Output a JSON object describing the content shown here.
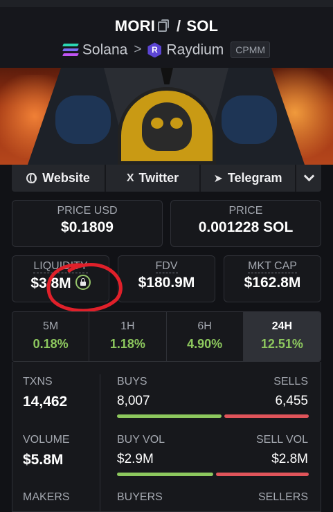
{
  "pair": {
    "base": "MORI",
    "separator": "/",
    "quote": "SOL"
  },
  "chain": {
    "network": "Solana",
    "dex": "Raydium",
    "dex_icon_letter": "R",
    "pool_type": "CPMM"
  },
  "icons": [
    "copy-icon",
    "solana-icon",
    "chevron-right-icon",
    "raydium-icon",
    "globe-icon",
    "x-icon",
    "telegram-icon",
    "chevron-down-icon",
    "lock-icon"
  ],
  "socials": {
    "website": "Website",
    "twitter": "Twitter",
    "telegram": "Telegram",
    "x_glyph": "X",
    "telegram_glyph": "➤"
  },
  "prices": {
    "price_usd_label": "PRICE USD",
    "price_usd": "$0.1809",
    "price_label": "PRICE",
    "price": "0.001228 SOL"
  },
  "metrics": {
    "liquidity_label": "LIQUIDITY",
    "liquidity": "$3.8M",
    "fdv_label": "FDV",
    "fdv": "$180.9M",
    "mktcap_label": "MKT CAP",
    "mktcap": "$162.8M"
  },
  "timeframes": [
    {
      "label": "5M",
      "change": "0.18%"
    },
    {
      "label": "1H",
      "change": "1.18%"
    },
    {
      "label": "6H",
      "change": "4.90%"
    },
    {
      "label": "24H",
      "change": "12.51%",
      "active": true
    }
  ],
  "stats": {
    "txns_label": "TXNS",
    "txns": "14,462",
    "buys_label": "BUYS",
    "buys": "8,007",
    "sells_label": "SELLS",
    "sells": "6,455",
    "volume_label": "VOLUME",
    "volume": "$5.8M",
    "buy_vol_label": "BUY VOL",
    "buy_vol": "$2.9M",
    "sell_vol_label": "SELL VOL",
    "sell_vol": "$2.8M",
    "makers_label": "MAKERS",
    "buyers_label": "BUYERS",
    "sellers_label": "SELLERS"
  },
  "ratios": {
    "buys_fraction": 0.553,
    "buy_vol_fraction": 0.509
  },
  "colors": {
    "positive": "#8dc85e",
    "buy_bar": "#8dc85e",
    "sell_bar": "#e0545a",
    "annotation": "#e0202a"
  }
}
